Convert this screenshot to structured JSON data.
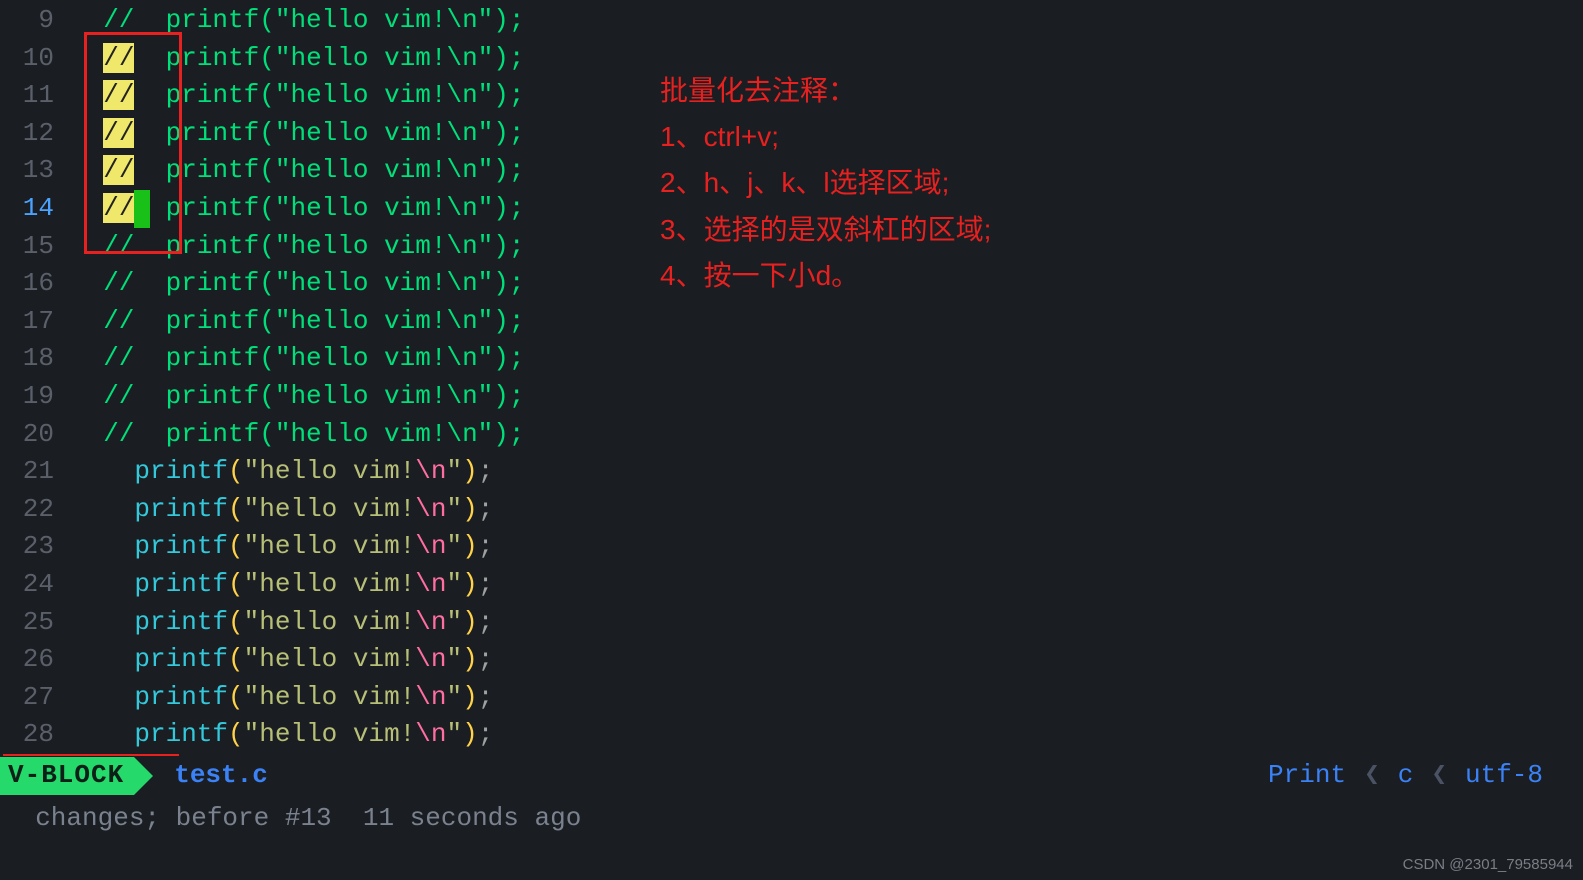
{
  "editor": {
    "current_line": 14,
    "lines": [
      {
        "num": 9,
        "commented": true,
        "selected": false,
        "indent": "  "
      },
      {
        "num": 10,
        "commented": true,
        "selected": true,
        "indent": "  "
      },
      {
        "num": 11,
        "commented": true,
        "selected": true,
        "indent": "  "
      },
      {
        "num": 12,
        "commented": true,
        "selected": true,
        "indent": "  "
      },
      {
        "num": 13,
        "commented": true,
        "selected": true,
        "indent": "  "
      },
      {
        "num": 14,
        "commented": true,
        "selected": true,
        "indent": "  ",
        "cursor_after_sel": true
      },
      {
        "num": 15,
        "commented": true,
        "selected": false,
        "indent": "  "
      },
      {
        "num": 16,
        "commented": true,
        "selected": false,
        "indent": "  "
      },
      {
        "num": 17,
        "commented": true,
        "selected": false,
        "indent": "  "
      },
      {
        "num": 18,
        "commented": true,
        "selected": false,
        "indent": "  "
      },
      {
        "num": 19,
        "commented": true,
        "selected": false,
        "indent": "  "
      },
      {
        "num": 20,
        "commented": true,
        "selected": false,
        "indent": "  "
      },
      {
        "num": 21,
        "commented": false,
        "selected": false,
        "indent": "    "
      },
      {
        "num": 22,
        "commented": false,
        "selected": false,
        "indent": "    "
      },
      {
        "num": 23,
        "commented": false,
        "selected": false,
        "indent": "    "
      },
      {
        "num": 24,
        "commented": false,
        "selected": false,
        "indent": "    "
      },
      {
        "num": 25,
        "commented": false,
        "selected": false,
        "indent": "    "
      },
      {
        "num": 26,
        "commented": false,
        "selected": false,
        "indent": "    "
      },
      {
        "num": 27,
        "commented": false,
        "selected": false,
        "indent": "    "
      },
      {
        "num": 28,
        "commented": false,
        "selected": false,
        "indent": "    "
      }
    ],
    "call": {
      "func": "printf",
      "lp": "(",
      "q1": "\"",
      "str": "hello vim!",
      "esc": "\\n",
      "q2": "\"",
      "rp": ")",
      "semi": ";"
    },
    "comment_prefix": "//",
    "comment_gap": "  "
  },
  "annotation": {
    "title": "批量化去注释：",
    "steps": [
      "1、ctrl+v;",
      "2、h、j、k、l选择区域;",
      "3、选择的是双斜杠的区域;",
      "4、按一下小d。"
    ]
  },
  "status": {
    "mode": "V-BLOCK",
    "filename": "test.c",
    "right_label": "Print",
    "filetype": "c",
    "encoding": "utf-8"
  },
  "message": "  changes; before #13  11 seconds ago",
  "watermark": "CSDN @2301_79585944"
}
